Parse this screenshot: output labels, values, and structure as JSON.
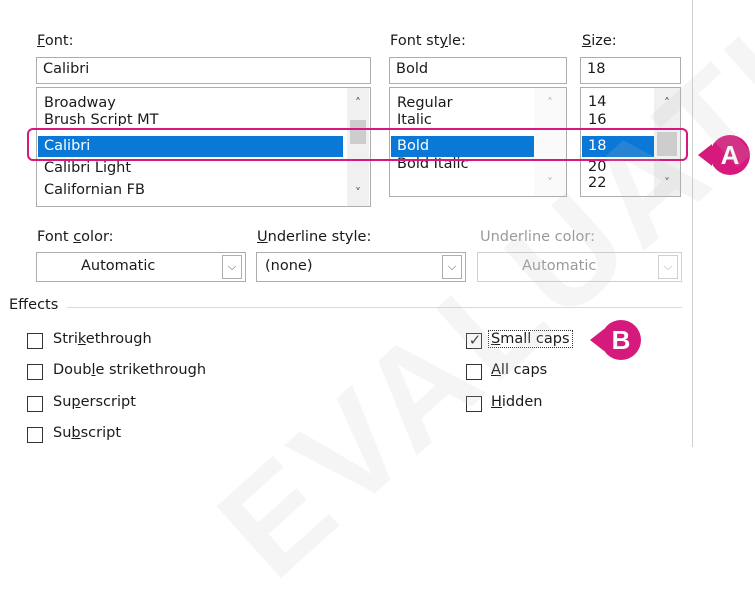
{
  "font": {
    "label_pre": "",
    "label_key": "F",
    "label_post": "ont:",
    "value": "Calibri",
    "items": [
      "Broadway",
      "Brush Script MT",
      "Calibri",
      "Calibri Light",
      "Californian FB"
    ]
  },
  "font_style": {
    "label_pre": "Font st",
    "label_key": "y",
    "label_post": "le:",
    "value": "Bold",
    "items": [
      "Regular",
      "Italic",
      "Bold",
      "Bold Italic"
    ]
  },
  "size": {
    "label_pre": "",
    "label_key": "S",
    "label_post": "ize:",
    "value": "18",
    "items": [
      "14",
      "16",
      "18",
      "20",
      "22"
    ]
  },
  "font_color": {
    "label_pre": "Font ",
    "label_key": "c",
    "label_post": "olor:",
    "value": "Automatic"
  },
  "underline_style": {
    "label_pre": "",
    "label_key": "U",
    "label_post": "nderline style:",
    "value": "(none)"
  },
  "underline_color": {
    "label": "Underline color:",
    "value": "Automatic"
  },
  "effects": {
    "title": "Effects",
    "strikethrough": {
      "pre": "Stri",
      "key": "k",
      "post": "ethrough",
      "checked": false
    },
    "double_strikethrough": {
      "pre": "Doub",
      "key": "l",
      "post": "e strikethrough",
      "checked": false
    },
    "superscript": {
      "pre": "Su",
      "key": "p",
      "post": "erscript",
      "checked": false
    },
    "subscript": {
      "pre": "Su",
      "key": "b",
      "post": "script",
      "checked": false
    },
    "small_caps": {
      "pre": "",
      "key": "S",
      "post": "mall caps",
      "checked": true
    },
    "all_caps": {
      "pre": "",
      "key": "A",
      "post": "ll caps",
      "checked": false
    },
    "hidden": {
      "pre": "",
      "key": "H",
      "post": "idden",
      "checked": false
    }
  },
  "callouts": {
    "a": "A",
    "b": "B",
    "color": "#d6197c"
  },
  "selection_color": "#0a78d7",
  "watermark": "EVALUATION",
  "icons": {
    "scroll_up": "chevron-up-icon",
    "scroll_down": "chevron-down-icon",
    "dropdown": "chevron-down-icon",
    "check": "checkmark-icon"
  }
}
